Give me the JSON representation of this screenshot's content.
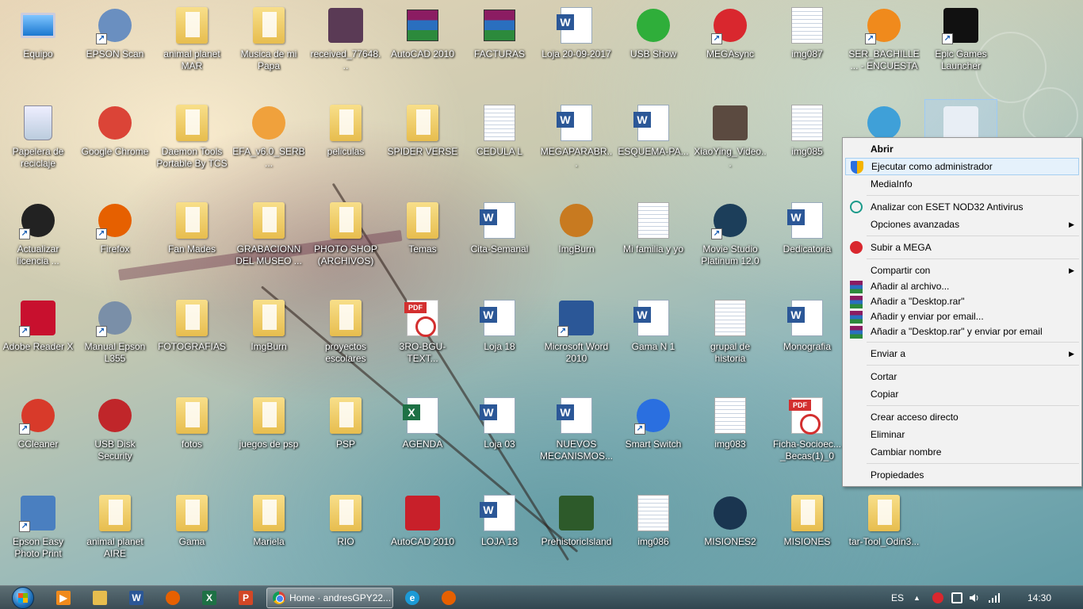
{
  "desktop": {
    "icons": [
      {
        "label": "Equipo",
        "type": "computer",
        "col": 0,
        "row": 0
      },
      {
        "label": "EPSON Scan",
        "type": "app",
        "color": "#6a8fc0",
        "shortcut": true,
        "col": 1,
        "row": 0
      },
      {
        "label": "animal planet MAR",
        "type": "folder",
        "col": 2,
        "row": 0
      },
      {
        "label": "Musica de mi Papa",
        "type": "folder",
        "col": 3,
        "row": 0
      },
      {
        "label": "received_77648...",
        "type": "square",
        "color": "#5a3a55",
        "col": 4,
        "row": 0
      },
      {
        "label": "AutoCAD 2010",
        "type": "rar",
        "col": 5,
        "row": 0
      },
      {
        "label": "FACTURAS",
        "type": "rar",
        "col": 6,
        "row": 0
      },
      {
        "label": "Loja 20-09-2017",
        "type": "word",
        "col": 7,
        "row": 0
      },
      {
        "label": "USB Show",
        "type": "app",
        "color": "#2fae3a",
        "col": 8,
        "row": 0
      },
      {
        "label": "MEGAsync",
        "type": "app",
        "color": "#d9272e",
        "shortcut": true,
        "col": 9,
        "row": 0
      },
      {
        "label": "img087",
        "type": "image",
        "col": 10,
        "row": 0
      },
      {
        "label": "SER_BACHILLE... - ENCUESTA",
        "type": "app",
        "color": "#f08a1c",
        "shortcut": true,
        "col": 11,
        "row": 0
      },
      {
        "label": "Epic Games Launcher",
        "type": "square",
        "color": "#111111",
        "shortcut": true,
        "col": 12,
        "row": 0
      },
      {
        "label": "Papelera de reciclaje",
        "type": "recycle",
        "col": 0,
        "row": 1
      },
      {
        "label": "Google Chrome",
        "type": "app",
        "color": "#db4437",
        "col": 1,
        "row": 1
      },
      {
        "label": "Daemon Tools Portable By TCS",
        "type": "folder",
        "col": 2,
        "row": 1
      },
      {
        "label": "EFA_v6.0_SERB...",
        "type": "app",
        "color": "#f0a13c",
        "col": 3,
        "row": 1
      },
      {
        "label": "peliculas",
        "type": "folder",
        "col": 4,
        "row": 1
      },
      {
        "label": "SPIDER VERSE",
        "type": "folder",
        "col": 5,
        "row": 1
      },
      {
        "label": "CEDULA L",
        "type": "image",
        "col": 6,
        "row": 1
      },
      {
        "label": "MEGAPARABR...",
        "type": "word",
        "col": 7,
        "row": 1
      },
      {
        "label": "ESQUEMA-PA...",
        "type": "word",
        "col": 8,
        "row": 1
      },
      {
        "label": "XiaoYing_Video...",
        "type": "square",
        "color": "#5b4a40",
        "col": 9,
        "row": 1
      },
      {
        "label": "img085",
        "type": "image",
        "col": 10,
        "row": 1
      },
      {
        "label": "",
        "type": "app",
        "color": "#3fa0d8",
        "col": 11,
        "row": 1
      },
      {
        "label": "",
        "type": "square",
        "color": "#e8eef5",
        "selected": true,
        "col": 12,
        "row": 1
      },
      {
        "label": "Actualizar licencia ...",
        "type": "app",
        "color": "#222222",
        "shortcut": true,
        "col": 0,
        "row": 2
      },
      {
        "label": "Firefox",
        "type": "app",
        "color": "#e66000",
        "shortcut": true,
        "col": 1,
        "row": 2
      },
      {
        "label": "Fan Mades",
        "type": "folder",
        "col": 2,
        "row": 2
      },
      {
        "label": "GRABACIONN DEL MUSEO ...",
        "type": "folder",
        "col": 3,
        "row": 2
      },
      {
        "label": "PHOTO SHOP (ARCHIVOS)",
        "type": "folder",
        "col": 4,
        "row": 2
      },
      {
        "label": "Temas",
        "type": "folder",
        "col": 5,
        "row": 2
      },
      {
        "label": "Cita-Semanal",
        "type": "word",
        "col": 6,
        "row": 2
      },
      {
        "label": "ImgBurn",
        "type": "app",
        "color": "#c87a20",
        "col": 7,
        "row": 2
      },
      {
        "label": "Mi familia y yo",
        "type": "image",
        "col": 8,
        "row": 2
      },
      {
        "label": "Movie Studio Platinum 12.0",
        "type": "app",
        "color": "#1c3e5a",
        "shortcut": true,
        "col": 9,
        "row": 2
      },
      {
        "label": "Dedicatoria",
        "type": "word",
        "col": 10,
        "row": 2
      },
      {
        "label": "Adobe Reader X",
        "type": "square",
        "color": "#c8102e",
        "shortcut": true,
        "col": 0,
        "row": 3
      },
      {
        "label": "Manual Epson L355",
        "type": "app",
        "color": "#7a8fa8",
        "shortcut": true,
        "col": 1,
        "row": 3
      },
      {
        "label": "FOTOGRAFIAS",
        "type": "folder",
        "col": 2,
        "row": 3
      },
      {
        "label": "ImgBurn",
        "type": "folder",
        "col": 3,
        "row": 3
      },
      {
        "label": "proyectos escolares",
        "type": "folder",
        "col": 4,
        "row": 3
      },
      {
        "label": "3RO-BGU-TEXT...",
        "type": "pdf",
        "col": 5,
        "row": 3
      },
      {
        "label": "Loja 18",
        "type": "word",
        "col": 6,
        "row": 3
      },
      {
        "label": "Microsoft Word 2010",
        "type": "square",
        "color": "#2b5797",
        "shortcut": true,
        "col": 7,
        "row": 3
      },
      {
        "label": "Gama N 1",
        "type": "word",
        "col": 8,
        "row": 3
      },
      {
        "label": "grupal de historia",
        "type": "image",
        "col": 9,
        "row": 3
      },
      {
        "label": "Monografia",
        "type": "word",
        "col": 10,
        "row": 3
      },
      {
        "label": "CCleaner",
        "type": "app",
        "color": "#d83a2a",
        "shortcut": true,
        "col": 0,
        "row": 4
      },
      {
        "label": "USB Disk Security",
        "type": "app",
        "color": "#c0262a",
        "col": 1,
        "row": 4
      },
      {
        "label": "fotos",
        "type": "folder",
        "col": 2,
        "row": 4
      },
      {
        "label": "juegos de psp",
        "type": "folder",
        "col": 3,
        "row": 4
      },
      {
        "label": "PSP",
        "type": "folder",
        "col": 4,
        "row": 4
      },
      {
        "label": "AGENDA",
        "type": "excel",
        "col": 5,
        "row": 4
      },
      {
        "label": "Loja 03",
        "type": "word",
        "col": 6,
        "row": 4
      },
      {
        "label": "NUEVOS MECANISMOS...",
        "type": "word",
        "col": 7,
        "row": 4
      },
      {
        "label": "Smart Switch",
        "type": "app",
        "color": "#2a6fe0",
        "shortcut": true,
        "col": 8,
        "row": 4
      },
      {
        "label": "img083",
        "type": "image",
        "col": 9,
        "row": 4
      },
      {
        "label": "Ficha-Socioec... _Becas(1)_0",
        "type": "pdf",
        "col": 10,
        "row": 4
      },
      {
        "label": "Epson Easy Photo Print",
        "type": "square",
        "color": "#4a7fc0",
        "shortcut": true,
        "col": 0,
        "row": 5
      },
      {
        "label": "animal planet AIRE",
        "type": "folder",
        "col": 1,
        "row": 5
      },
      {
        "label": "Gama",
        "type": "folder",
        "col": 2,
        "row": 5
      },
      {
        "label": "Mariela",
        "type": "folder",
        "col": 3,
        "row": 5
      },
      {
        "label": "RIO",
        "type": "folder",
        "col": 4,
        "row": 5
      },
      {
        "label": "AutoCAD 2010",
        "type": "square",
        "color": "#c8202a",
        "col": 5,
        "row": 5
      },
      {
        "label": "LOJA 13",
        "type": "word",
        "col": 6,
        "row": 5
      },
      {
        "label": "PrehistoricIsland",
        "type": "square",
        "color": "#2d5a2a",
        "col": 7,
        "row": 5
      },
      {
        "label": "img086",
        "type": "image",
        "col": 8,
        "row": 5
      },
      {
        "label": "MISIONES2",
        "type": "app",
        "color": "#1a3550",
        "col": 9,
        "row": 5
      },
      {
        "label": "MISIONES",
        "type": "folder",
        "col": 10,
        "row": 5
      },
      {
        "label": "tar-Tool_Odin3...",
        "type": "folder",
        "col": 11,
        "row": 5
      }
    ]
  },
  "context_menu": {
    "items": [
      {
        "label": "Abrir",
        "bold": true
      },
      {
        "label": "Ejecutar como administrador",
        "icon": "uac-shield-icon",
        "highlight": true
      },
      {
        "label": "MediaInfo"
      },
      {
        "separator": true
      },
      {
        "label": "Analizar con ESET NOD32 Antivirus",
        "icon": "eset-icon"
      },
      {
        "label": "Opciones avanzadas",
        "submenu": true
      },
      {
        "separator": true
      },
      {
        "label": "Subir a MEGA",
        "icon": "mega-icon"
      },
      {
        "separator": true
      },
      {
        "label": "Compartir con",
        "submenu": true
      },
      {
        "label": "Añadir al archivo...",
        "icon": "winrar-icon",
        "compact": true
      },
      {
        "label": "Añadir a \"Desktop.rar\"",
        "icon": "winrar-icon",
        "compact": true
      },
      {
        "label": "Añadir y enviar por email...",
        "icon": "winrar-icon",
        "compact": true
      },
      {
        "label": "Añadir a \"Desktop.rar\" y enviar por email",
        "icon": "winrar-icon",
        "compact": true
      },
      {
        "separator": true
      },
      {
        "label": "Enviar a",
        "submenu": true
      },
      {
        "separator": true
      },
      {
        "label": "Cortar"
      },
      {
        "label": "Copiar"
      },
      {
        "separator": true
      },
      {
        "label": "Crear acceso directo"
      },
      {
        "label": "Eliminar"
      },
      {
        "label": "Cambiar nombre"
      },
      {
        "separator": true
      },
      {
        "label": "Propiedades"
      }
    ]
  },
  "taskbar": {
    "pinned": [
      {
        "name": "media-player-icon",
        "color": "#f08a1c",
        "glyph": "▶"
      },
      {
        "name": "explorer-icon",
        "color": "#e7bd4e",
        "glyph": ""
      },
      {
        "name": "word-icon",
        "color": "#2b5797",
        "glyph": "W"
      },
      {
        "name": "firefox-icon",
        "color": "#e66000",
        "glyph": ""
      },
      {
        "name": "excel-icon",
        "color": "#1e7145",
        "glyph": "X"
      },
      {
        "name": "powerpoint-icon",
        "color": "#d24726",
        "glyph": "P"
      }
    ],
    "active_task": "Home · andresGPY22...",
    "after_task": [
      {
        "name": "ie-icon",
        "color": "#1c9ad6",
        "glyph": "e"
      },
      {
        "name": "firefox-icon",
        "color": "#e66000",
        "glyph": ""
      }
    ],
    "language": "ES",
    "clock": "14:30"
  },
  "colors": {
    "highlight_bg": "#e5f1fb",
    "highlight_border": "#a6cff1"
  }
}
